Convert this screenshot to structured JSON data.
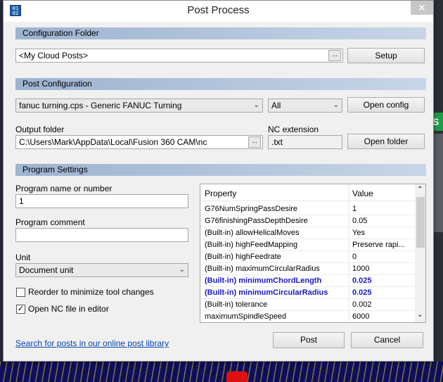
{
  "window": {
    "title": "Post Process",
    "icon": "app-icon",
    "close": "✕"
  },
  "config_folder": {
    "header": "Configuration Folder",
    "value": "<My Cloud Posts>",
    "browse": "...",
    "setup_button": "Setup"
  },
  "post_config": {
    "header": "Post Configuration",
    "selected_post": "fanuc turning.cps - Generic FANUC Turning",
    "filter": "All",
    "open_config_button": "Open config",
    "output_folder_label": "Output folder",
    "output_folder_value": "C:\\Users\\Mark\\AppData\\Local\\Fusion 360 CAM\\nc",
    "browse": "...",
    "nc_extension_label": "NC extension",
    "nc_extension_value": ".txt",
    "open_folder_button": "Open folder"
  },
  "program_settings": {
    "header": "Program Settings",
    "program_name_label": "Program name or number",
    "program_name_value": "1",
    "program_comment_label": "Program comment",
    "program_comment_value": "",
    "unit_label": "Unit",
    "unit_value": "Document unit",
    "reorder_label": "Reorder to minimize tool changes",
    "reorder_checked": false,
    "open_nc_label": "Open NC file in editor",
    "open_nc_checked": true
  },
  "properties": {
    "header_property": "Property",
    "header_value": "Value",
    "rows": [
      {
        "name": "G76NumSpringPassDesire",
        "value": "1",
        "bold": false
      },
      {
        "name": "G76finishingPassDepthDesire",
        "value": "0.05",
        "bold": false
      },
      {
        "name": "(Built-in) allowHelicalMoves",
        "value": "Yes",
        "bold": false
      },
      {
        "name": "(Built-in) highFeedMapping",
        "value": "Preserve rapi...",
        "bold": false
      },
      {
        "name": "(Built-in) highFeedrate",
        "value": "0",
        "bold": false
      },
      {
        "name": "(Built-in) maximumCircularRadius",
        "value": "1000",
        "bold": false
      },
      {
        "name": "(Built-in) minimumChordLength",
        "value": "0.025",
        "bold": true
      },
      {
        "name": "(Built-in) minimumCircularRadius",
        "value": "0.025",
        "bold": true
      },
      {
        "name": "(Built-in) tolerance",
        "value": "0.002",
        "bold": false
      },
      {
        "name": "maximumSpindleSpeed",
        "value": "6000",
        "bold": false
      }
    ]
  },
  "footer": {
    "search_link": "Search for posts in our online post library",
    "post_button": "Post",
    "cancel_button": "Cancel"
  },
  "background": {
    "green_tab": "S"
  }
}
